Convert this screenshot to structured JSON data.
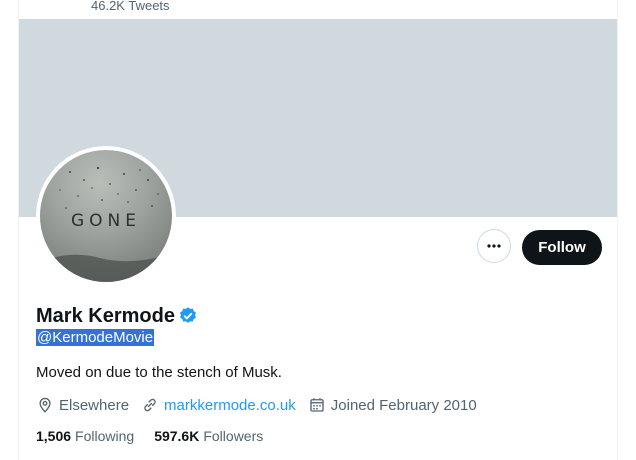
{
  "header": {
    "tweet_count": "46.2K Tweets"
  },
  "profile": {
    "avatar_text": "GONE",
    "name": "Mark Kermode",
    "handle": "@KermodeMovie",
    "bio": "Moved on due to the stench of Musk.",
    "location": "Elsewhere",
    "website": "markkermode.co.uk",
    "joined": "Joined February 2010",
    "following_count": "1,506",
    "following_label": "Following",
    "followers_count": "597.6K",
    "followers_label": "Followers"
  },
  "actions": {
    "follow_label": "Follow",
    "more_icon": "more-horizontal-icon"
  },
  "colors": {
    "banner": "#cfd9de",
    "accent": "#1d9bf0",
    "follow_button": "#0f1419",
    "selection_highlight": "#3373d6"
  }
}
